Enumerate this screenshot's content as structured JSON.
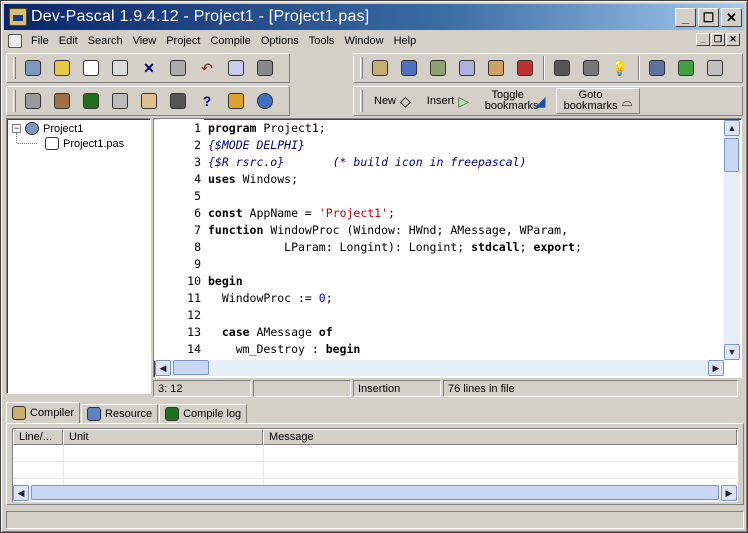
{
  "window": {
    "title": "Dev-Pascal 1.9.4.12 - Project1 - [Project1.pas]"
  },
  "menu": [
    "File",
    "Edit",
    "Search",
    "View",
    "Project",
    "Compile",
    "Options",
    "Tools",
    "Window",
    "Help"
  ],
  "toolbar2": {
    "new_label": "New",
    "insert_label": "Insert",
    "toggle_bookmarks_label": "Toggle bookmarks",
    "goto_bookmarks_label": "Goto bookmarks"
  },
  "tree": {
    "project": "Project1",
    "file": "Project1.pas",
    "expander": "−"
  },
  "editor": {
    "lines": [
      "program Project1;",
      "{$MODE DELPHI}",
      "{$R rsrc.o}       (* build icon in freepascal)",
      "uses Windows;",
      "",
      "const AppName = 'Project1';",
      "function WindowProc (Window: HWnd; AMessage, WParam,",
      "           LParam: Longint): Longint; stdcall; export;",
      "",
      "begin",
      "  WindowProc := 0;",
      "",
      "  case AMessage of",
      "    wm_Destroy : begin"
    ],
    "line_numbers": [
      "1",
      "2",
      "3",
      "4",
      "5",
      "6",
      "7",
      "8",
      "9",
      "10",
      "11",
      "12",
      "13",
      "14"
    ]
  },
  "status": {
    "position": "3: 12",
    "mode": "Insertion",
    "lines": "76 lines in file"
  },
  "bottom_tabs": [
    "Compiler",
    "Resource",
    "Compile log"
  ],
  "compiler_table": {
    "columns": [
      "Line/...",
      "Unit",
      "Message"
    ]
  }
}
